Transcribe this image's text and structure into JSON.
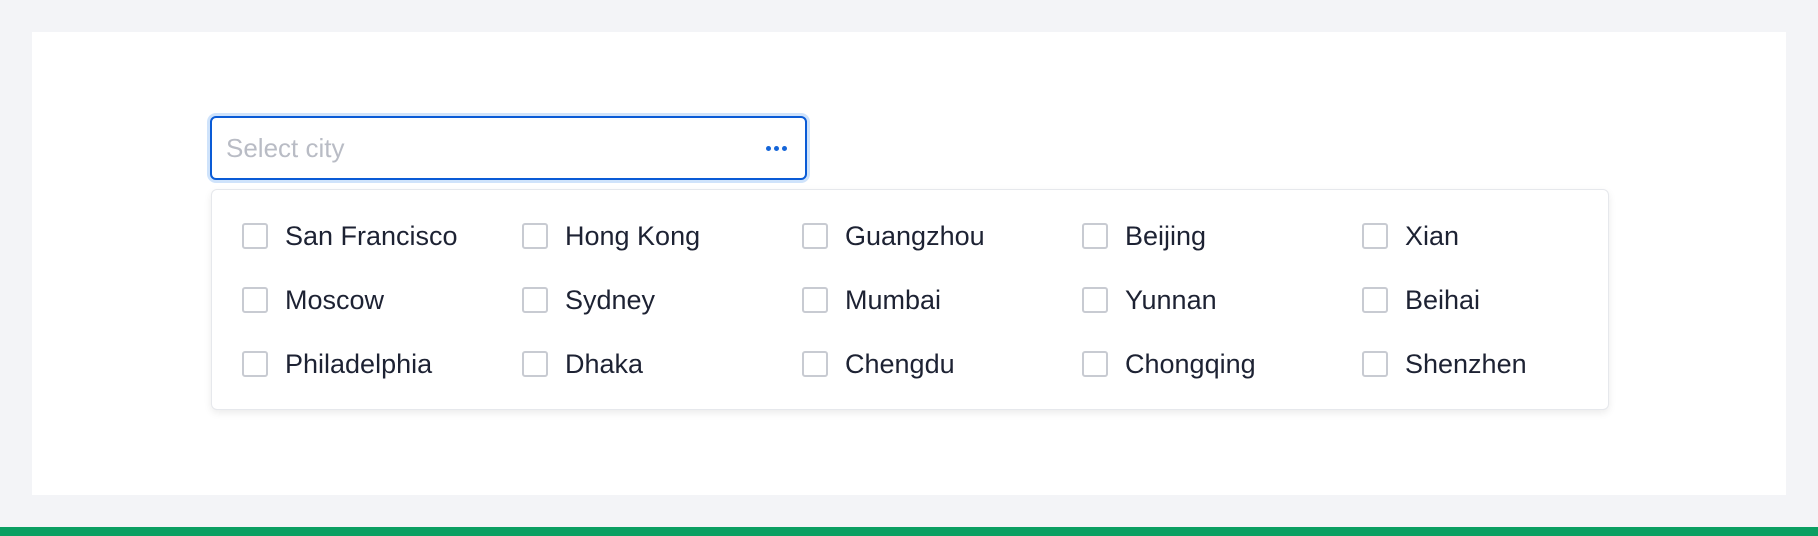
{
  "select": {
    "placeholder": "Select city",
    "more_icon": "ellipsis-icon",
    "accent_color": "#0a5bd6"
  },
  "options": [
    {
      "label": "San Francisco",
      "checked": false
    },
    {
      "label": "Hong Kong",
      "checked": false
    },
    {
      "label": "Guangzhou",
      "checked": false
    },
    {
      "label": "Beijing",
      "checked": false
    },
    {
      "label": "Xian",
      "checked": false
    },
    {
      "label": "Moscow",
      "checked": false
    },
    {
      "label": "Sydney",
      "checked": false
    },
    {
      "label": "Mumbai",
      "checked": false
    },
    {
      "label": "Yunnan",
      "checked": false
    },
    {
      "label": "Beihai",
      "checked": false
    },
    {
      "label": "Philadelphia",
      "checked": false
    },
    {
      "label": "Dhaka",
      "checked": false
    },
    {
      "label": "Chengdu",
      "checked": false
    },
    {
      "label": "Chongqing",
      "checked": false
    },
    {
      "label": "Shenzhen",
      "checked": false
    }
  ],
  "colors": {
    "page_background": "#f3f4f7",
    "bottom_bar": "#0a9f62"
  }
}
